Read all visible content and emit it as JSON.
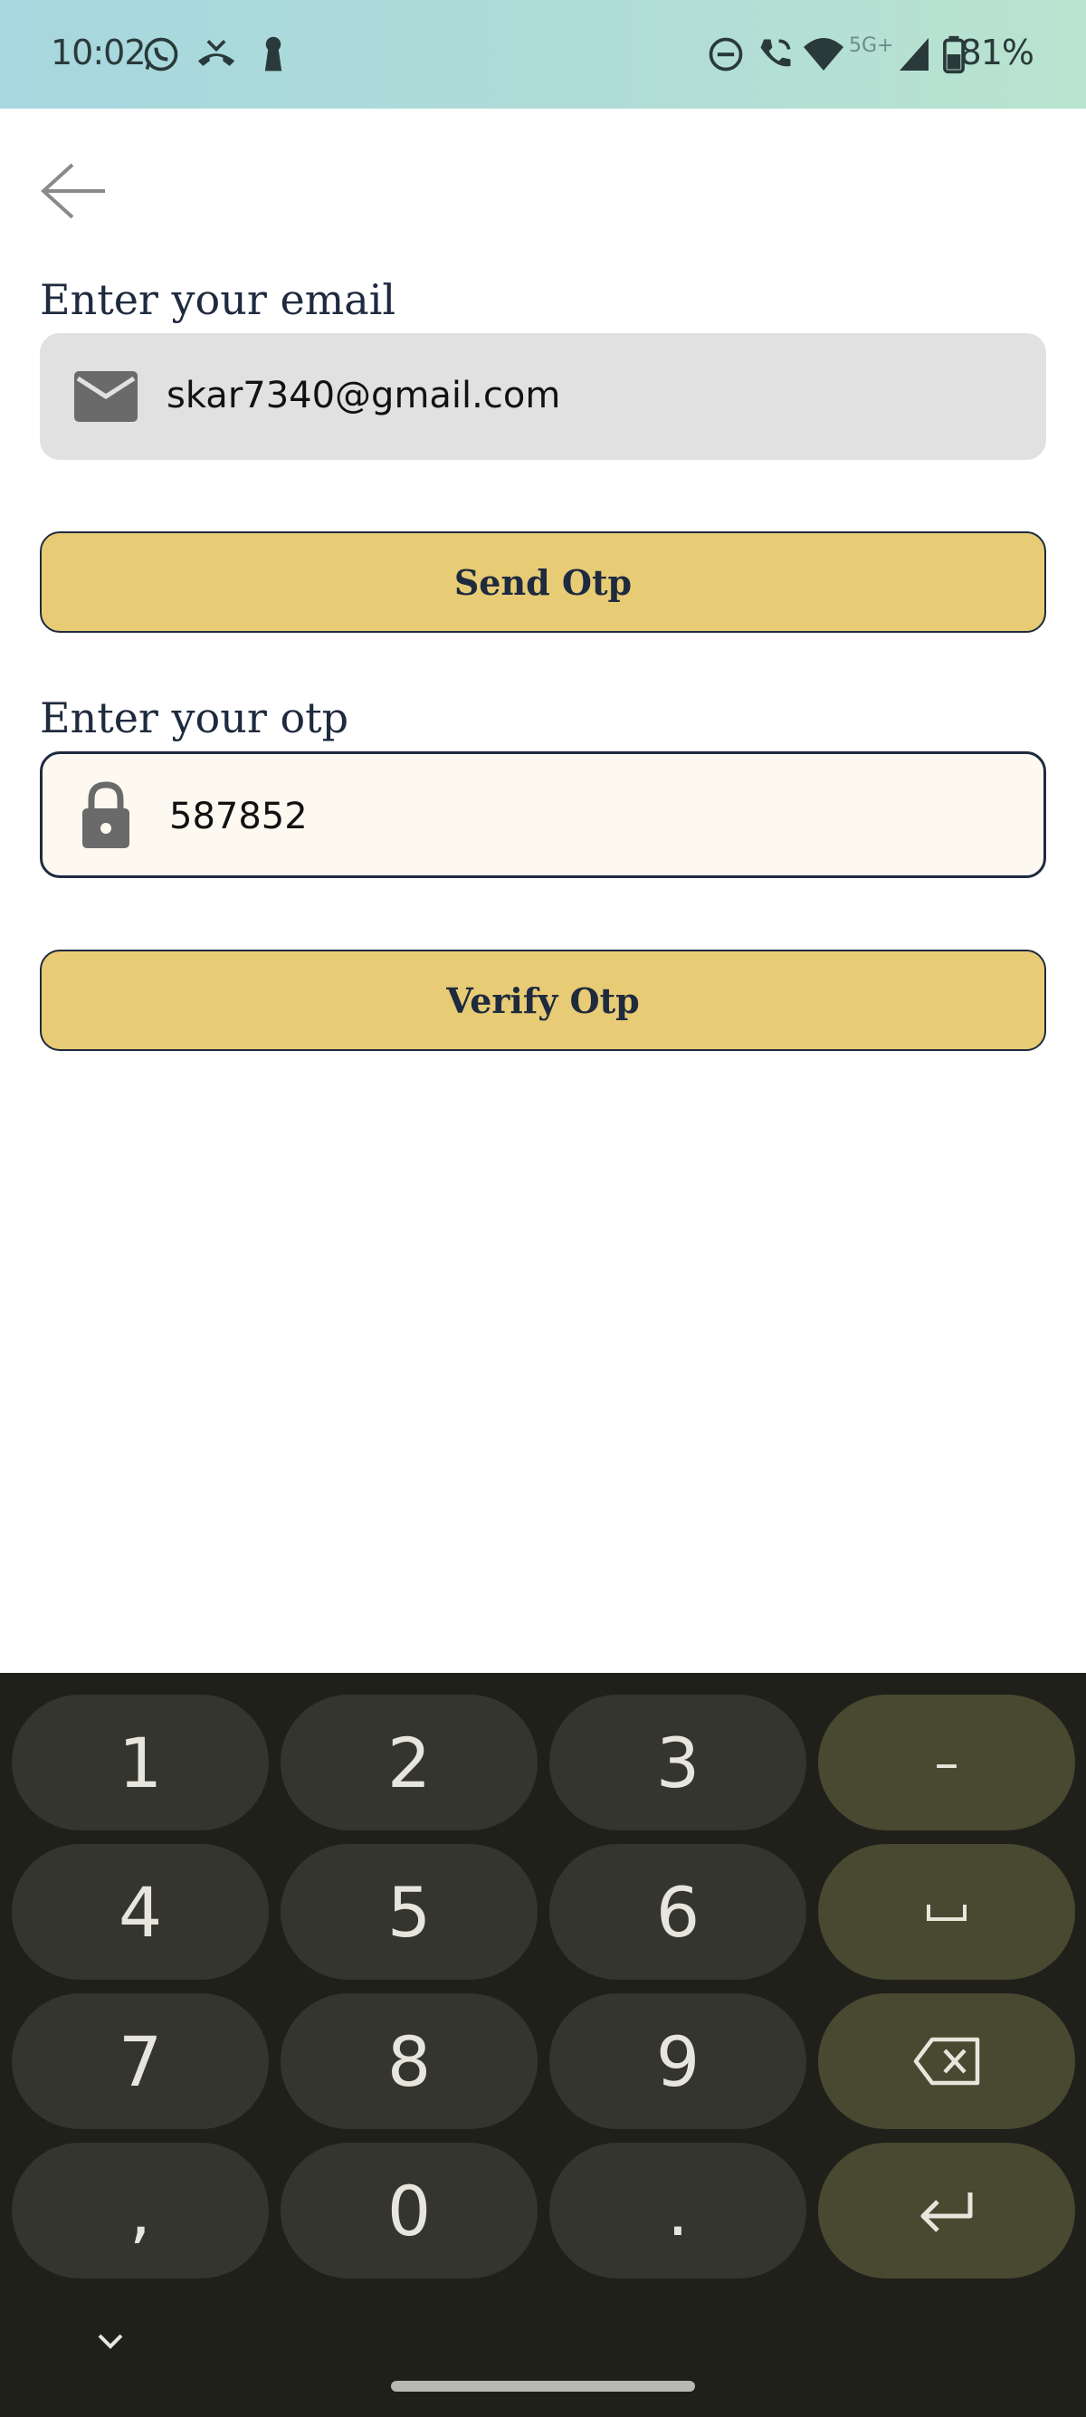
{
  "status_bar": {
    "time": "10:02",
    "network": "5G+",
    "battery": "81%",
    "icons": [
      "whatsapp-icon",
      "missed-call-icon",
      "keyhole-icon",
      "dnd-icon",
      "wifi-call-icon",
      "wifi-icon",
      "signal-icon",
      "battery-icon"
    ]
  },
  "app_bar": {
    "back_icon": "arrow-left-icon"
  },
  "email_section": {
    "label": "Enter your email",
    "icon": "mail-icon",
    "value": "skar7340@gmail.com",
    "button_label": "Send Otp"
  },
  "otp_section": {
    "label": "Enter your otp",
    "icon": "lock-icon",
    "value": "587852",
    "button_label": "Verify Otp"
  },
  "keyboard": {
    "rows": [
      [
        "1",
        "2",
        "3",
        "–"
      ],
      [
        "4",
        "5",
        "6",
        "space"
      ],
      [
        "7",
        "8",
        "9",
        "backspace"
      ],
      [
        ",",
        "0",
        ".",
        "enter"
      ]
    ],
    "keys": {
      "k1": "1",
      "k2": "2",
      "k3": "3",
      "dash": "–",
      "k4": "4",
      "k5": "5",
      "k6": "6",
      "k7": "7",
      "k8": "8",
      "k9": "9",
      "comma": ",",
      "k0": "0",
      "period": "."
    }
  },
  "colors": {
    "status_bar_start": "#a7d8df",
    "status_bar_end": "#b9e4cf",
    "button_fill": "#e8cb75",
    "text_dark": "#1e2a3e",
    "email_field_bg": "#e1e1e1",
    "otp_field_bg": "#fdf9f1",
    "keyboard_bg": "#1f201a",
    "key_bg": "#34352e",
    "func_key_bg": "#484930"
  }
}
